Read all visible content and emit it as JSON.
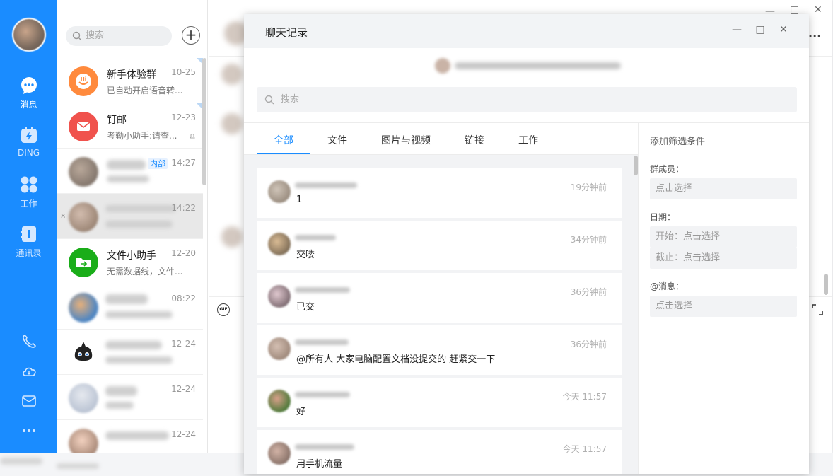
{
  "nav": {
    "items": [
      {
        "label": "消息",
        "icon": "chat-icon"
      },
      {
        "label": "DING",
        "icon": "ding-icon"
      },
      {
        "label": "工作",
        "icon": "apps-icon"
      },
      {
        "label": "通讯录",
        "icon": "contacts-icon"
      }
    ],
    "bottom_icons": [
      "phone-icon",
      "cloud-icon",
      "mail-icon",
      "more-icon"
    ]
  },
  "list": {
    "search_placeholder": "搜索",
    "add_label": "+",
    "items": [
      {
        "name": "新手体验群",
        "time": "10-25",
        "sub": "已自动开启语音转...",
        "color": "#ff8a3d"
      },
      {
        "name": "钉邮",
        "time": "12-23",
        "sub": "考勤小助手:请查...",
        "color": "#f0524d"
      },
      {
        "name": "",
        "time": "14:27",
        "sub": "",
        "tag": "内部"
      },
      {
        "name": "",
        "time": "14:22",
        "sub": ""
      },
      {
        "name": "文件小助手",
        "time": "12-20",
        "sub": "无需数据线，文件...",
        "color": "#1aad19"
      },
      {
        "name": "",
        "time": "08:22",
        "sub": ""
      },
      {
        "name": "",
        "time": "12-24",
        "sub": ""
      },
      {
        "name": "",
        "time": "12-24",
        "sub": ""
      },
      {
        "name": "",
        "time": "12-24",
        "sub": ""
      }
    ]
  },
  "main": {
    "gif_label": "GIF",
    "more_label": "..."
  },
  "dialog": {
    "title": "聊天记录",
    "search_placeholder": "搜索",
    "tabs": [
      "全部",
      "文件",
      "图片与视频",
      "链接",
      "工作"
    ],
    "messages": [
      {
        "time": "19分钟前",
        "text": "1"
      },
      {
        "time": "34分钟前",
        "text": "交喽"
      },
      {
        "time": "36分钟前",
        "text": "已交"
      },
      {
        "time": "36分钟前",
        "text": "@所有人 大家电脑配置文档没提交的 赶紧交一下"
      },
      {
        "time": "今天 11:57",
        "text": "好"
      },
      {
        "time": "今天 11:57",
        "text": "用手机流量"
      }
    ],
    "filter": {
      "title": "添加筛选条件",
      "member_label": "群成员：",
      "member_value": "点击选择",
      "date_label": "日期：",
      "date_start": "开始：点击选择",
      "date_end": "截止：点击选择",
      "at_label": "@消息：",
      "at_value": "点击选择"
    }
  },
  "colors": {
    "accent": "#1a8cff",
    "nav_bg": "#1a8cff"
  }
}
